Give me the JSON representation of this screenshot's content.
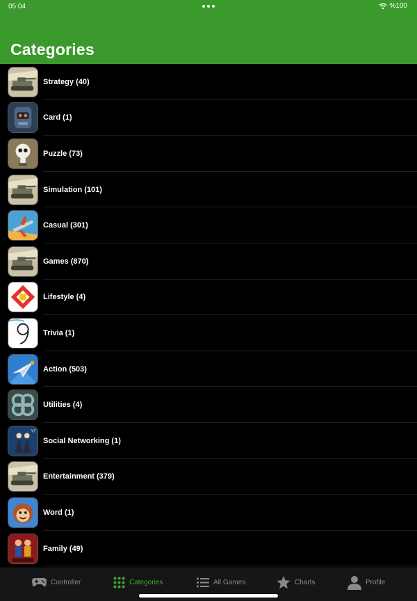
{
  "status": {
    "time": "05:04",
    "battery": "%100"
  },
  "header": {
    "title": "Categories"
  },
  "categories": [
    {
      "label": "Strategy (40)",
      "icon": "tank-icon"
    },
    {
      "label": "Card (1)",
      "icon": "robot-icon"
    },
    {
      "label": "Puzzle (73)",
      "icon": "skull-icon"
    },
    {
      "label": "Simulation (101)",
      "icon": "tank-icon"
    },
    {
      "label": "Casual (301)",
      "icon": "plane-icon"
    },
    {
      "label": "Games (870)",
      "icon": "tank-icon"
    },
    {
      "label": "Lifestyle (4)",
      "icon": "square-pattern-icon"
    },
    {
      "label": "Trivia (1)",
      "icon": "number-nine-icon"
    },
    {
      "label": "Action (503)",
      "icon": "paper-plane-icon"
    },
    {
      "label": "Utilities (4)",
      "icon": "loops-icon"
    },
    {
      "label": "Social Networking (1)",
      "icon": "two-figures-icon"
    },
    {
      "label": "Entertainment (379)",
      "icon": "tank-icon"
    },
    {
      "label": "Word (1)",
      "icon": "monkey-face-icon"
    },
    {
      "label": "Family (49)",
      "icon": "fighters-icon"
    }
  ],
  "tabs": [
    {
      "label": "Controller",
      "icon": "gamepad-icon"
    },
    {
      "label": "Categories",
      "icon": "grid-icon"
    },
    {
      "label": "All Games",
      "icon": "list-icon"
    },
    {
      "label": "Charts",
      "icon": "star-icon"
    },
    {
      "label": "Profile",
      "icon": "person-icon"
    }
  ],
  "colors": {
    "header": "#3a9a2b",
    "active_tab": "#3fa834",
    "inactive_tab": "#8a8a8a",
    "background": "#000000"
  }
}
